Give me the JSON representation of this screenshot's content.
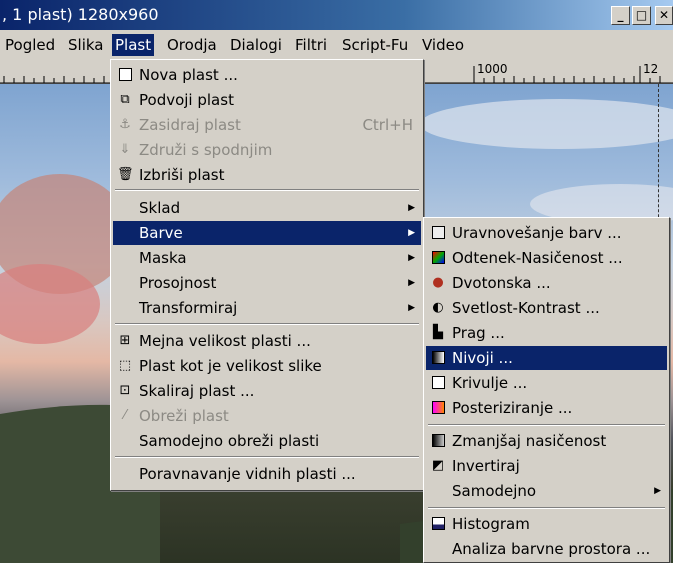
{
  "window": {
    "title": ", 1 plast) 1280x960"
  },
  "menubar": [
    {
      "label": "Pogled"
    },
    {
      "label": "Slika"
    },
    {
      "label": "Plast"
    },
    {
      "label": "Orodja"
    },
    {
      "label": "Dialogi"
    },
    {
      "label": "Filtri"
    },
    {
      "label": "Script-Fu"
    },
    {
      "label": "Video"
    }
  ],
  "ruler": {
    "mark_1000": "1000",
    "mark_12": "12"
  },
  "plast_menu": [
    {
      "label": "Nova plast ...",
      "icon": "new-layer-icon"
    },
    {
      "label": "Podvoji plast",
      "icon": "duplicate-layer-icon"
    },
    {
      "label": "Zasidraj plast",
      "icon": "anchor-icon",
      "shortcut": "Ctrl+H",
      "disabled": true
    },
    {
      "label": "Združi s spodnjim",
      "icon": "merge-down-icon",
      "disabled": true
    },
    {
      "label": "Izbriši plast",
      "icon": "delete-layer-icon"
    },
    {
      "label": "Sklad",
      "submenu": true
    },
    {
      "label": "Barve",
      "submenu": true,
      "highlighted": true
    },
    {
      "label": "Maska",
      "submenu": true
    },
    {
      "label": "Prosojnost",
      "submenu": true
    },
    {
      "label": "Transformiraj",
      "submenu": true
    },
    {
      "label": "Mejna velikost plasti ...",
      "icon": "layer-boundary-icon"
    },
    {
      "label": "Plast kot je velikost slike",
      "icon": "layer-to-image-size-icon"
    },
    {
      "label": "Skaliraj plast ...",
      "icon": "scale-layer-icon"
    },
    {
      "label": "Obreži plast",
      "icon": "crop-icon",
      "disabled": true
    },
    {
      "label": "Samodejno obreži plasti"
    },
    {
      "label": "Poravnavanje vidnih plasti ..."
    }
  ],
  "barve_menu": [
    {
      "label": "Uravnovešanje barv ...",
      "icon": "color-balance-icon"
    },
    {
      "label": "Odtenek-Nasičenost ...",
      "icon": "hue-saturation-icon"
    },
    {
      "label": "Dvotonska ...",
      "icon": "colorize-icon"
    },
    {
      "label": "Svetlost-Kontrast ...",
      "icon": "brightness-contrast-icon"
    },
    {
      "label": "Prag ...",
      "icon": "threshold-icon"
    },
    {
      "label": "Nivoji ...",
      "icon": "levels-icon",
      "highlighted": true
    },
    {
      "label": "Krivulje ...",
      "icon": "curves-icon"
    },
    {
      "label": "Posteriziranje ...",
      "icon": "posterize-icon"
    },
    {
      "label": "Zmanjšaj nasičenost",
      "icon": "desaturate-icon"
    },
    {
      "label": "Invertiraj",
      "icon": "invert-icon"
    },
    {
      "label": "Samodejno",
      "submenu": true
    },
    {
      "label": "Histogram",
      "icon": "histogram-icon"
    },
    {
      "label": "Analiza barvne prostora ..."
    }
  ]
}
